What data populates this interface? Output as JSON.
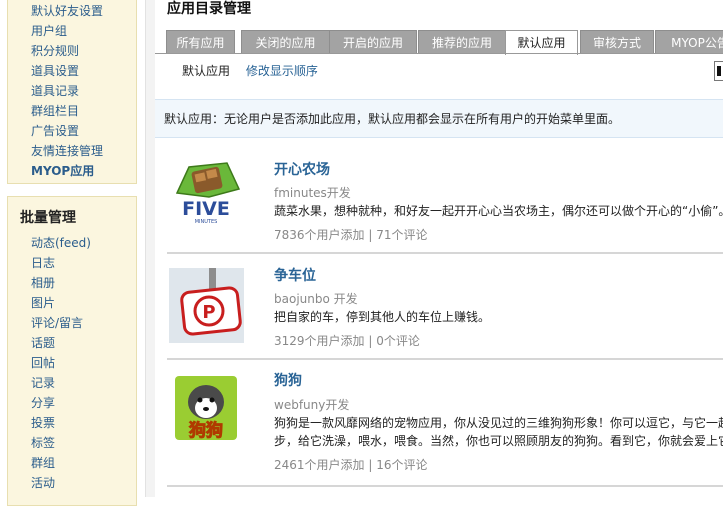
{
  "sidebar": {
    "top_items": [
      {
        "label": "默认好友设置"
      },
      {
        "label": "用户组"
      },
      {
        "label": "积分规则"
      },
      {
        "label": "道具设置"
      },
      {
        "label": "道具记录"
      },
      {
        "label": "群组栏目"
      },
      {
        "label": "广告设置"
      },
      {
        "label": "友情连接管理"
      },
      {
        "label": "MYOP应用"
      }
    ],
    "batch_title": "批量管理",
    "batch_items": [
      {
        "label": "动态(feed)"
      },
      {
        "label": "日志"
      },
      {
        "label": "相册"
      },
      {
        "label": "图片"
      },
      {
        "label": "评论/留言"
      },
      {
        "label": "话题"
      },
      {
        "label": "回帖"
      },
      {
        "label": "记录"
      },
      {
        "label": "分享"
      },
      {
        "label": "投票"
      },
      {
        "label": "标签"
      },
      {
        "label": "群组"
      },
      {
        "label": "活动"
      }
    ]
  },
  "main": {
    "title": "应用目录管理",
    "tabs": [
      {
        "label": "所有应用"
      },
      {
        "label": "关闭的应用"
      },
      {
        "label": "开启的应用"
      },
      {
        "label": "推荐的应用"
      },
      {
        "label": "默认应用"
      },
      {
        "label": "审核方式"
      },
      {
        "label": "MYOP公告"
      }
    ],
    "active_tab": "默认应用",
    "subnav": {
      "current": "默认应用",
      "link": "修改显示顺序"
    },
    "notice": "默认应用：无论用户是否添加此应用，默认应用都会显示在所有用户的开始菜单里面。",
    "apps": [
      {
        "name": "开心农场",
        "developer": "fminutes开发",
        "description": "蔬菜水果，想种就种，和好友一起开开心心当农场主，偶尔还可以做个开心的“小偷”。",
        "stats": "7836个用户添加 | 71个评论",
        "icon": "five-minutes-farm-icon",
        "icon_text": "FIVE",
        "icon_subtext": "MINUTES"
      },
      {
        "name": "争车位",
        "developer": "baojunbo 开发",
        "description": "把自家的车，停到其他人的车位上赚钱。",
        "stats": "3129个用户添加 | 0个评论",
        "icon": "parking-sign-icon",
        "icon_text": "P"
      },
      {
        "name": "狗狗",
        "developer": "webfuny开发",
        "description": "狗狗是一款风靡网络的宠物应用，你从没见过的三维狗狗形象！你可以逗它，与它一起散步，给它洗澡，喂水，喂食。当然，你也可以照顾朋友的狗狗。看到它，你就会爱上它！",
        "stats": "2461个用户添加 | 16个评论",
        "icon": "husky-dog-icon",
        "icon_text": "狗狗"
      }
    ]
  },
  "colors": {
    "sidebar_bg": "#fbf6df",
    "link": "#2a6496",
    "tab_inactive": "#a3a3a3",
    "notice_bg": "#f1f7fc"
  }
}
